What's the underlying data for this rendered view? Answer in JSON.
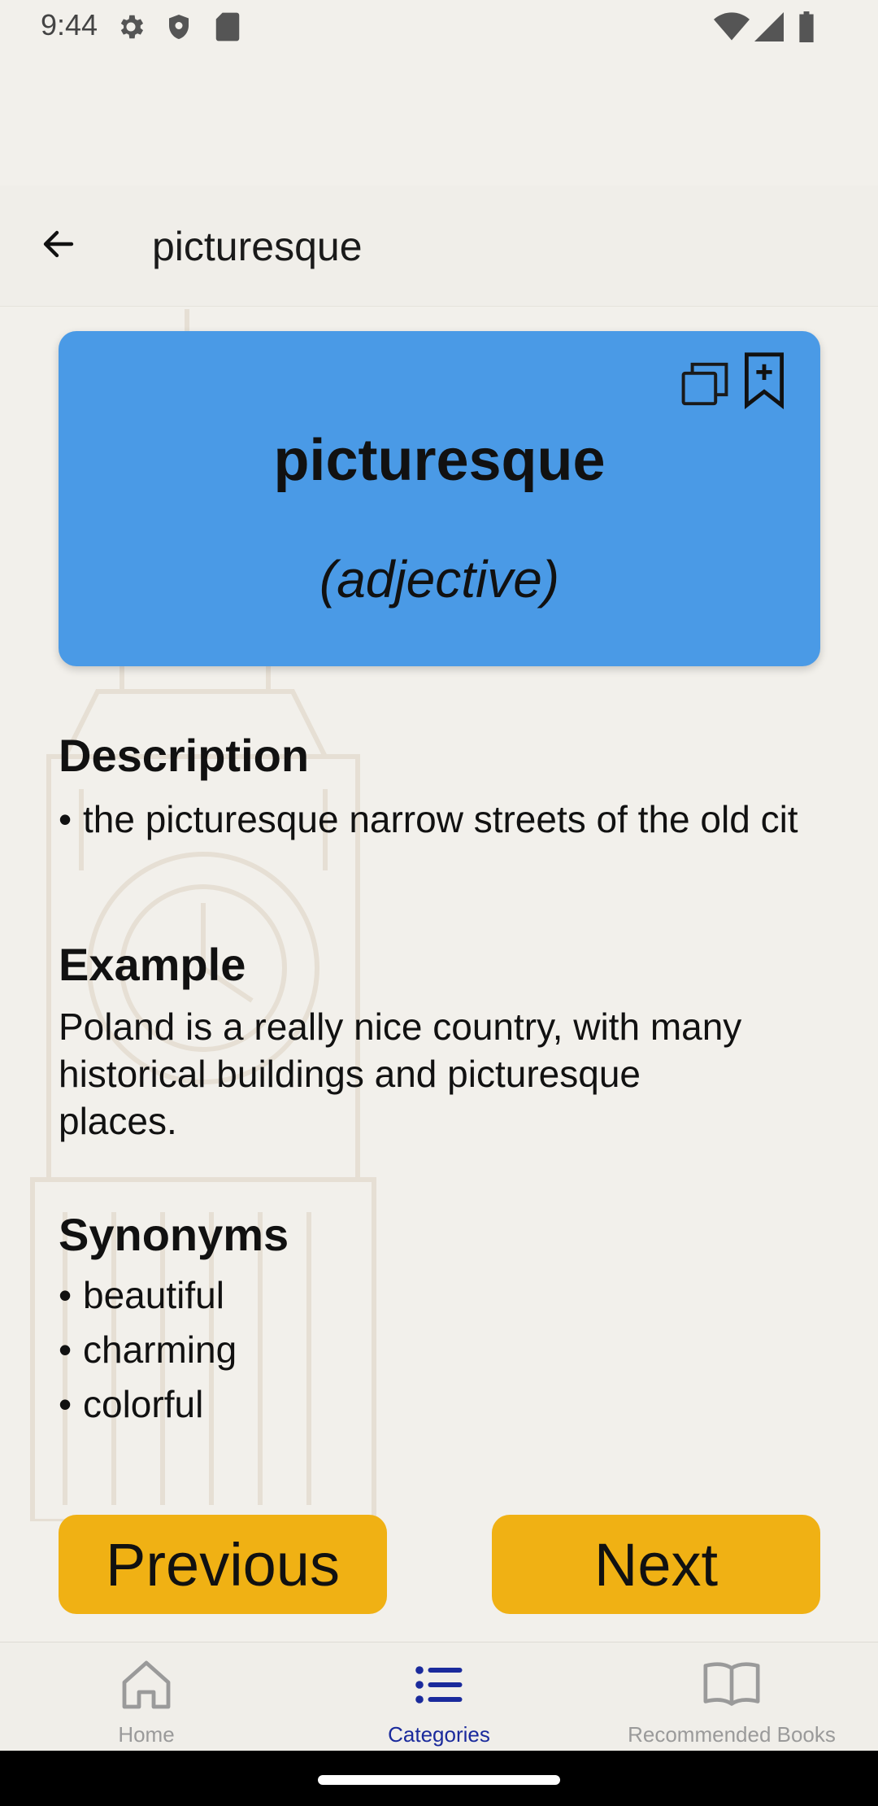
{
  "status_bar": {
    "time": "9:44",
    "icons_left": [
      "gear-icon",
      "shield-icon",
      "sd-card-icon"
    ],
    "icons_right": [
      "wifi-icon",
      "signal-icon",
      "battery-icon"
    ]
  },
  "header": {
    "title": "picturesque",
    "back_icon": "arrow-left-icon"
  },
  "card": {
    "word": "picturesque",
    "part_of_speech": "(adjective)",
    "color": "#4a9ae6",
    "icons": [
      "copy-icon",
      "bookmark-add-icon"
    ]
  },
  "description": {
    "title": "Description",
    "items": [
      "the picturesque narrow streets of the old cit"
    ]
  },
  "example": {
    "title": "Example",
    "lines": [
      "Poland is a really nice country, with many",
      "historical buildings and picturesque",
      "places."
    ]
  },
  "synonyms": {
    "title": "Synonyms",
    "items": [
      "beautiful",
      "charming",
      "colorful"
    ]
  },
  "buttons": {
    "previous": "Previous",
    "next": "Next",
    "color": "#f0b114"
  },
  "bottom_nav": {
    "items": [
      {
        "label": "Home",
        "icon": "home-icon",
        "active": false
      },
      {
        "label": "Categories",
        "icon": "list-icon",
        "active": true
      },
      {
        "label": "Recommended Books",
        "icon": "book-icon",
        "active": false
      }
    ],
    "active_color": "#1a2a9c",
    "inactive_color": "#9a9a9a"
  }
}
